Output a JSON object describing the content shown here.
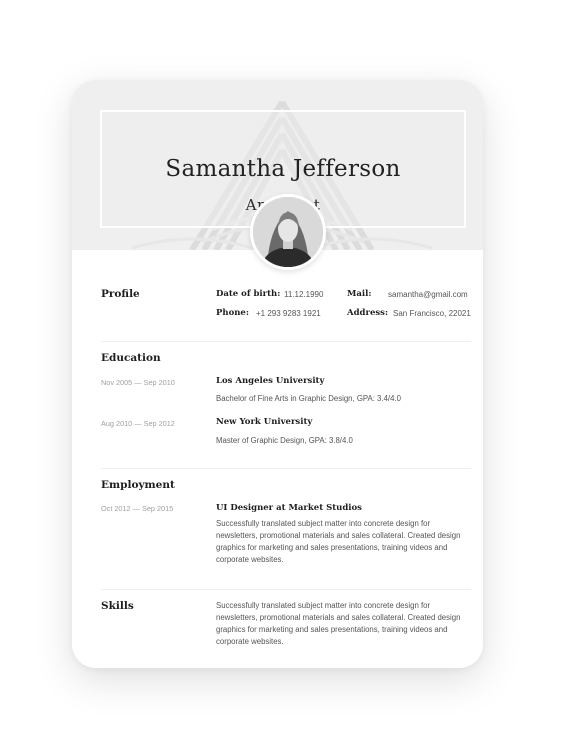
{
  "header": {
    "name": "Samantha Jefferson",
    "role": "Architect"
  },
  "profile": {
    "title": "Profile",
    "dob_label": "Date of birth:",
    "dob_value": "11.12.1990",
    "mail_label": "Mail:",
    "mail_value": "samantha@gmail.com",
    "phone_label": "Phone:",
    "phone_value": "+1 293 9283 1921",
    "address_label": "Address:",
    "address_value": "San Francisco, 22021"
  },
  "education": {
    "title": "Education",
    "items": [
      {
        "dates": "Nov 2005 — Sep 2010",
        "school": "Los Angeles University",
        "degree": "Bachelor of Fine Arts in Graphic Design, GPA: 3.4/4.0"
      },
      {
        "dates": "Aug 2010 — Sep 2012",
        "school": "New York University",
        "degree": "Master of Graphic Design, GPA: 3.8/4.0"
      }
    ]
  },
  "employment": {
    "title": "Employment",
    "items": [
      {
        "dates": "Oct 2012 — Sep 2015",
        "position": "UI Designer at Market Studios",
        "description": "Successfully translated subject matter into concrete design for newsletters, promotional materials and sales collateral. Created design graphics for marketing and sales presentations, training videos and corporate websites."
      }
    ]
  },
  "skills": {
    "title": "Skills",
    "description": "Successfully translated subject matter into concrete design for newsletters, promotional materials and sales collateral. Created design graphics for marketing and sales presentations, training videos and corporate websites."
  }
}
